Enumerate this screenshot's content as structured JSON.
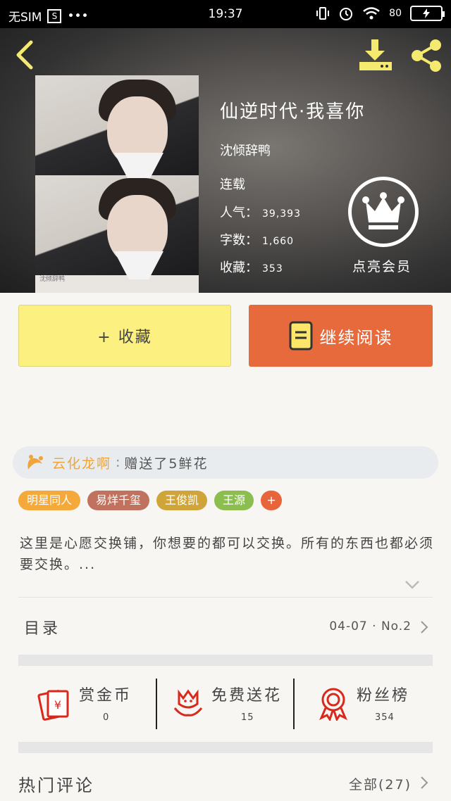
{
  "status_bar": {
    "carrier": "无SIM",
    "sim_slot": "S",
    "dots": "•••",
    "time": "19:37",
    "battery_pct": "80",
    "icons": [
      "vibrate-icon",
      "alarm-icon",
      "wifi-icon",
      "battery-charging-icon"
    ]
  },
  "header": {
    "back_icon": "back-chevron-icon",
    "download_icon": "download-icon",
    "share_icon": "share-icon"
  },
  "book": {
    "title": "仙逆时代·我喜你",
    "author": "沈倾辞鸭",
    "status": "连载",
    "popularity_label": "人气：",
    "popularity_value": "39,393",
    "wordcount_label": "字数：",
    "wordcount_value": "1,660",
    "favorites_label": "收藏：",
    "favorites_value": "353",
    "cover_watermark": "沈倾辞鸭"
  },
  "vip": {
    "label": "点亮会员",
    "icon": "crown-icon"
  },
  "buttons": {
    "collect": "+ 收藏",
    "continue_read": "继续阅读"
  },
  "gift_banner": {
    "user": "云化龙啊",
    "separator": ":",
    "message": "赠送了5鲜花"
  },
  "tags": [
    {
      "label": "明星同人",
      "color": "#f5a93a"
    },
    {
      "label": "易烊千玺",
      "color": "#c0725f"
    },
    {
      "label": "王俊凯",
      "color": "#cfa53a"
    },
    {
      "label": "王源",
      "color": "#8bbd4f"
    }
  ],
  "tag_add": "+",
  "description": "这里是心愿交换铺，你想要的都可以交换。所有的东西也都必须要交换。...",
  "toc": {
    "title": "目录",
    "info": "04-07 · No.2"
  },
  "actions": [
    {
      "label": "赏金币",
      "count": "0",
      "icon": "red-envelope-icon"
    },
    {
      "label": "免费送花",
      "count": "15",
      "icon": "flower-icon"
    },
    {
      "label": "粉丝榜",
      "count": "354",
      "icon": "medal-icon"
    }
  ],
  "comments": {
    "title": "热门评论",
    "all": "全部(27)"
  },
  "colors": {
    "accent_orange": "#e66a3c",
    "collect_yellow": "#fbf080",
    "gift_user": "#f0a43a",
    "icon_red": "#d9281c"
  }
}
